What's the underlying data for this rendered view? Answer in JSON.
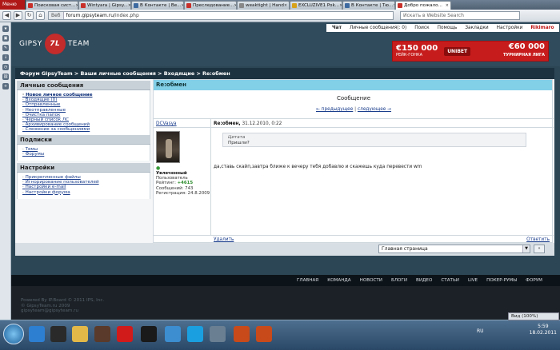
{
  "browser": {
    "menu_label": "Меню",
    "tabs": [
      {
        "title": "Поисковая сист...",
        "color": "#c8302a"
      },
      {
        "title": "Wintyara | Gipsy...",
        "color": "#c8302a"
      },
      {
        "title": "В Контакте | Ве...",
        "color": "#3d6aa0"
      },
      {
        "title": "Преследование...",
        "color": "#c8302a"
      },
      {
        "title": "weaktight | Hand",
        "color": "#888888"
      },
      {
        "title": "EXCLUZIVE1 Pok...",
        "color": "#d7a21a"
      },
      {
        "title": "В Контакте | Тю...",
        "color": "#3d6aa0"
      },
      {
        "title": "Добро пожало...",
        "color": "#c8302a"
      }
    ],
    "address_badge": "Веб",
    "url_domain": "forum.gipsyteam.ru",
    "url_path": "/index.php",
    "search_placeholder": "Искать в Website Search"
  },
  "header": {
    "logo_left": "GIPSY",
    "logo_mark": "7L",
    "logo_right": "TEAM",
    "topnav": [
      {
        "label": "Чат",
        "style": "bold"
      },
      {
        "label": "Личные сообщения(: 0)",
        "style": ""
      },
      {
        "label": "Поиск",
        "style": ""
      },
      {
        "label": "Помощь",
        "style": ""
      },
      {
        "label": "Закладки",
        "style": ""
      },
      {
        "label": "Настройки",
        "style": ""
      },
      {
        "label": "Rikimaro",
        "style": "red"
      }
    ],
    "banner": {
      "left_amount": "€150 000",
      "left_sub": "РЕЙК-ГОНКА",
      "brand": "UNIBET",
      "right_amount": "€60 000",
      "right_sub": "ТУРНИРНАЯ ЛИГА"
    }
  },
  "breadcrumb": "Форум GipsyTeam  >  Ваши личные сообщения  >  Входящие  >  Re:обмен",
  "sidebar": {
    "sections": [
      {
        "title": "Личные сообщения",
        "items": [
          {
            "label": "Новое личное сообщение",
            "bold": true
          },
          {
            "label": "Входящие (0)",
            "bold": false
          },
          {
            "label": "Отправленные",
            "bold": false
          },
          {
            "label": "Неотправленные",
            "bold": false
          },
          {
            "label": "Очистка папок",
            "bold": false
          },
          {
            "label": "Черный список ЛС",
            "bold": false
          },
          {
            "label": "Архивирование сообщений",
            "bold": false
          },
          {
            "label": "Слежение за сообщениями",
            "bold": false
          }
        ]
      },
      {
        "title": "Подписки",
        "items": [
          {
            "label": "Темы",
            "bold": false
          },
          {
            "label": "Форумы",
            "bold": false
          }
        ]
      },
      {
        "title": "Настройки",
        "items": [
          {
            "label": "Прикрепленные файлы",
            "bold": false
          },
          {
            "label": "Игнорирование пользователей",
            "bold": false
          },
          {
            "label": "Настройки e-mail",
            "bold": false
          },
          {
            "label": "Настройки форума",
            "bold": false
          }
        ]
      }
    ]
  },
  "message": {
    "header": "Re:обмен",
    "title": "Сообщение",
    "prev_label": "← предыдущее",
    "separator": "|",
    "next_label": "следующее →",
    "author": "DCVasya",
    "post_subject": "Re:обмен,",
    "post_date": "31.12.2010, 0:22",
    "online_dot": "●",
    "user_title": "Увлеченный",
    "user_group": "Пользователь",
    "rating_label": "Рейтинг:",
    "rating_value": "+4615",
    "messages_line": "Сообщений: 743",
    "registered_line": "Регистрация: 24.8.2009",
    "quote_label": "Цитата",
    "quote_text": "Пришли?",
    "body": "да,ставь скайп,завтра ближе к вечеру тебя добавлю и скажешь куда перевести wm",
    "delete_label": "Удалить",
    "reply_label": "Ответить"
  },
  "jump": {
    "selected": "Главная страница",
    "go_label": "»"
  },
  "footer_nav": [
    "ГЛАВНАЯ",
    "КОМАНДА",
    "НОВОСТИ",
    "БЛОГИ",
    "ВИДЕО",
    "СТАТЬИ",
    "LIVE",
    "ПОКЕР-РУМЫ",
    "ФОРУМ"
  ],
  "footer_lines": [
    "Powered By IP.Board © 2011  IPS, Inc.",
    "© GipsyTeam.ru 2009",
    "gipsyteam@gipsyteam.ru"
  ],
  "status": {
    "zoom_label": "Вид (100%)",
    "lang": "RU",
    "time": "5:59",
    "date": "18.02.2011"
  },
  "taskbar_apps": [
    {
      "name": "ie",
      "color": "#2d7fd1"
    },
    {
      "name": "ub",
      "color": "#2a2a2a"
    },
    {
      "name": "folder",
      "color": "#e2b948"
    },
    {
      "name": "poker-app",
      "color": "#5a3a2a"
    },
    {
      "name": "opera",
      "color": "#d11a1a"
    },
    {
      "name": "fulltilt",
      "color": "#1a1a1a"
    },
    {
      "name": "network",
      "color": "#3c8ed0"
    },
    {
      "name": "skype",
      "color": "#1aa0e0"
    },
    {
      "name": "screen",
      "color": "#6a7f92"
    },
    {
      "name": "pokerstars-1",
      "color": "#c84a1a"
    },
    {
      "name": "pokerstars-2",
      "color": "#c84a1a"
    }
  ]
}
